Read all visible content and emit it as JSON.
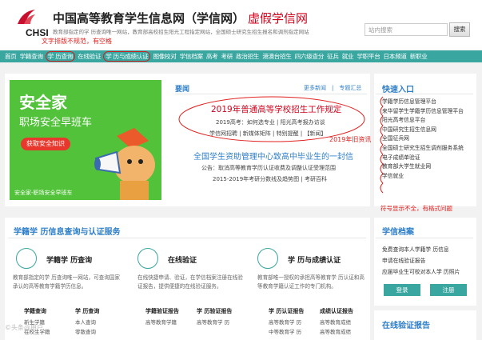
{
  "header": {
    "logo_text": "CHSI",
    "title": "中国高等教育学生信息网（学信网）",
    "title_suffix": "虚假学信网",
    "subtitle": "教育部指定的学 历查询唯一网站，教育部高校招生阳光工程指定网站，全国硕士研究生招生报名和调剂指定网站",
    "note": "文字排版不规范，有空格",
    "search_placeholder": "站内搜索",
    "search_button": "搜索"
  },
  "nav": {
    "items": [
      "首页",
      "学籍查询",
      "学 历查询",
      "在线验证",
      "学 历与成绩认证",
      "图像校对",
      "学信档案",
      "高考",
      "考研",
      "政治招生",
      "港澳台招生",
      "四六级查分",
      "征兵",
      "就业",
      "学职平台",
      "日本频道",
      "新职业"
    ]
  },
  "ad": {
    "headline": "安全家",
    "tagline": "职场安全早班车",
    "button": "获取安全知识",
    "footer": "安全家-职场安全早班车"
  },
  "news": {
    "heading": "要闻",
    "links": "更多新闻　|　专题汇总",
    "headline_red": "2019年普通高等学校招生工作规定",
    "line1": "2019高考：如何选专业 | 阳光高考报办访谈",
    "line2": "学信网招聘 | 新媒体矩阵 | 特别提醒 | 【新闻】",
    "note_fake": "2019年旧资讯",
    "headline_blue": "全国学生资助管理中心致高中毕业生的一封信",
    "line3": "公告：取消高等教育学历认证收费及调整认证受理范围",
    "line4": "2015-2019年考研分数线及趋势图 | 考研百科"
  },
  "quick": {
    "heading": "快速入口",
    "items": [
      "学籍学历信息管理平台",
      "来华留学生学籍学历信息管理平台",
      "阳光高考信息平台",
      "中国研究生招生信息网",
      "全国征兵网",
      "全国硕士研究生招生调剂服务系统",
      "电子成绩单验证",
      "教育部大学生就业网",
      "学信就业"
    ],
    "note": "符号显示不全，有格式问题"
  },
  "services": {
    "heading": "学籍学 历信息查询与认证服务",
    "cards": [
      {
        "title": "学籍学 历查询",
        "desc": "教育部指定的学 历查询唯一网站，可查询国家承认的高等教育学籍学历信息。",
        "col1_head": "学籍查询",
        "col1_items": [
          "新生学籍",
          "在校生学籍"
        ],
        "col2_head": "学 历查询",
        "col2_items": [
          "本人查询",
          "零散查询"
        ]
      },
      {
        "title": "在线验证",
        "desc": "在线快捷申请、验证，在学信档案注册在线验证报告，提供便捷的在线验证服务。",
        "col1_head": "学籍验证报告",
        "col1_items": [
          "高等教育学籍"
        ],
        "col2_head": "学 历验证报告",
        "col2_items": [
          "高等教育学 历"
        ]
      },
      {
        "title": "学 历与成绩认证",
        "desc": "教育部唯一授权的承担高等教育学 历认证和高等教育学籍认证工作的专门机构。",
        "col1_head": "学 历认证报告",
        "col1_items": [
          "高等教育学 历",
          "中等教育学 历"
        ],
        "col2_head": "成绩认证报告",
        "col2_items": [
          "高等教育成绩",
          "高等教育成绩"
        ]
      }
    ]
  },
  "archive": {
    "heading": "学信档案",
    "items": [
      "免费查询本人学籍学 历信息",
      "申请在线验证报告",
      "应届毕业生可校对本人学 历照片"
    ],
    "login": "登录",
    "register": "注册",
    "verify_heading": "在线验证报告"
  },
  "watermark": "©头条@用户"
}
